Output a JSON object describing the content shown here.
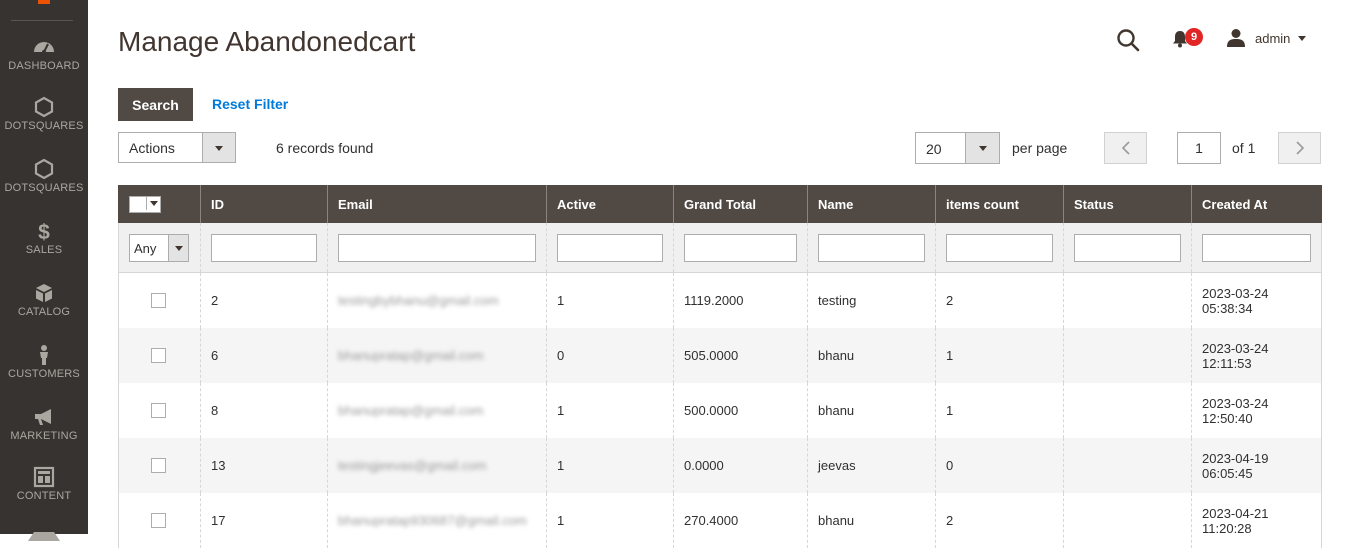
{
  "sidebar": {
    "items": [
      {
        "label": "DASHBOARD",
        "icon": "dashboard-icon"
      },
      {
        "label": "DOTSQUARES",
        "icon": "hexagon-icon"
      },
      {
        "label": "DOTSQUARES",
        "icon": "hexagon-icon"
      },
      {
        "label": "SALES",
        "icon": "dollar-icon"
      },
      {
        "label": "CATALOG",
        "icon": "box-icon"
      },
      {
        "label": "CUSTOMERS",
        "icon": "person-icon"
      },
      {
        "label": "MARKETING",
        "icon": "megaphone-icon"
      },
      {
        "label": "CONTENT",
        "icon": "layout-icon"
      }
    ]
  },
  "header": {
    "title": "Manage Abandonedcart",
    "notifications_count": "9",
    "user": "admin"
  },
  "toolbar": {
    "search_label": "Search",
    "reset_label": "Reset Filter",
    "actions_label": "Actions",
    "records_found": "6 records found",
    "per_page_value": "20",
    "per_page_label": "per page",
    "current_page": "1",
    "of_pages": "of 1"
  },
  "table": {
    "columns": [
      "ID",
      "Email",
      "Active",
      "Grand Total",
      "Name",
      "items count",
      "Status",
      "Created At"
    ],
    "filter_any": "Any",
    "rows": [
      {
        "id": "2",
        "email": "testingbybhanu@gmail.com",
        "active": "1",
        "grand_total": "1119.2000",
        "name": "testing",
        "items_count": "2",
        "status": "",
        "created_date": "2023-03-24",
        "created_time": "05:38:34"
      },
      {
        "id": "6",
        "email": "bhanupratap@gmail.com",
        "active": "0",
        "grand_total": "505.0000",
        "name": "bhanu",
        "items_count": "1",
        "status": "",
        "created_date": "2023-03-24",
        "created_time": "12:11:53"
      },
      {
        "id": "8",
        "email": "bhanupratap@gmail.com",
        "active": "1",
        "grand_total": "500.0000",
        "name": "bhanu",
        "items_count": "1",
        "status": "",
        "created_date": "2023-03-24",
        "created_time": "12:50:40"
      },
      {
        "id": "13",
        "email": "testingjeevas@gmail.com",
        "active": "1",
        "grand_total": "0.0000",
        "name": "jeevas",
        "items_count": "0",
        "status": "",
        "created_date": "2023-04-19",
        "created_time": "06:05:45"
      },
      {
        "id": "17",
        "email": "bhanupratap930687@gmail.com",
        "active": "1",
        "grand_total": "270.4000",
        "name": "bhanu",
        "items_count": "2",
        "status": "",
        "created_date": "2023-04-21",
        "created_time": "11:20:28"
      }
    ]
  }
}
